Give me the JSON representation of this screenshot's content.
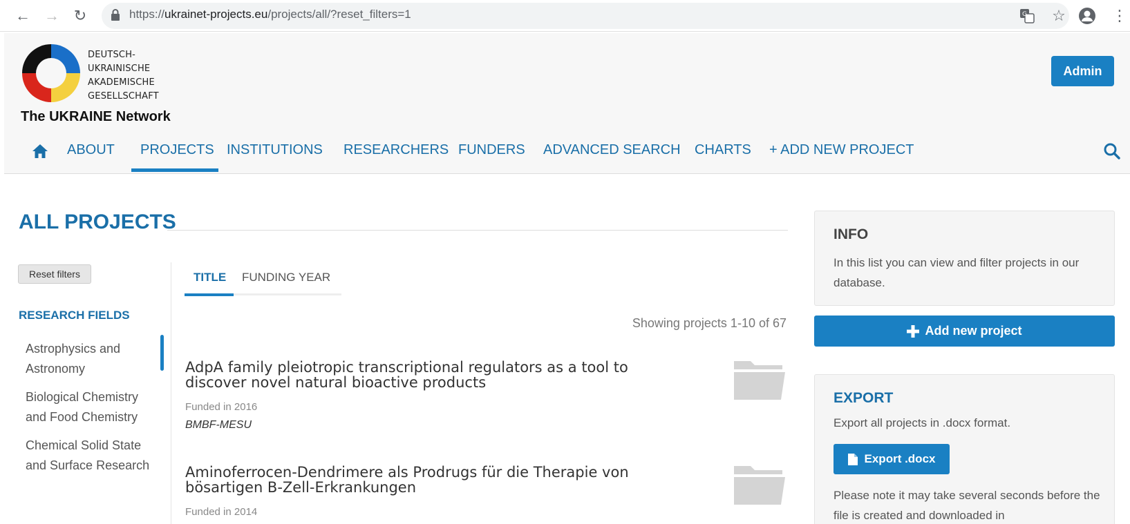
{
  "browser": {
    "url_scheme": "https://",
    "url_host": "ukrainet-projects.eu",
    "url_path": "/projects/all/?reset_filters=1"
  },
  "header": {
    "logo_lines": [
      "DEUTSCH-",
      "UKRAINISCHE",
      "AKADEMISCHE",
      "GESELLSCHAFT"
    ],
    "network_name": "The UKRAINE Network",
    "admin_label": "Admin"
  },
  "nav": {
    "items": [
      "ABOUT",
      "PROJECTS",
      "INSTITUTIONS",
      "RESEARCHERS",
      "FUNDERS",
      "ADVANCED SEARCH",
      "CHARTS",
      "+ ADD NEW PROJECT"
    ],
    "active": "PROJECTS"
  },
  "main": {
    "title": "ALL PROJECTS",
    "reset_label": "Reset filters",
    "research_fields_heading": "RESEARCH FIELDS",
    "research_fields": [
      "Astrophysics and Astronomy",
      "Biological Chemistry and Food Chemistry",
      "Chemical Solid State and Surface Research"
    ],
    "sort_tabs": [
      "TITLE",
      "FUNDING YEAR"
    ],
    "showing": "Showing projects 1-10 of 67",
    "projects": [
      {
        "title": "AdpA family pleiotropic transcriptional regulators as a tool to discover novel natural bioactive products",
        "funded": "Funded in 2016",
        "funder": "BMBF-MESU"
      },
      {
        "title": "Aminoferrocen-Dendrimere als Prodrugs für die Therapie von bösartigen B-Zell-Erkrankungen",
        "funded": "Funded in 2014",
        "funder": ""
      }
    ]
  },
  "sidebar": {
    "info_title": "INFO",
    "info_text": "In this list you can view and filter projects in our database.",
    "add_project_label": "Add new project",
    "export_title": "EXPORT",
    "export_text": "Export all projects in .docx format.",
    "export_btn_label": "Export .docx",
    "export_note": "Please note it may take several seconds before the file is created and downloaded in"
  },
  "colors": {
    "accent": "#1a80c3",
    "link": "#1a6fa8"
  }
}
